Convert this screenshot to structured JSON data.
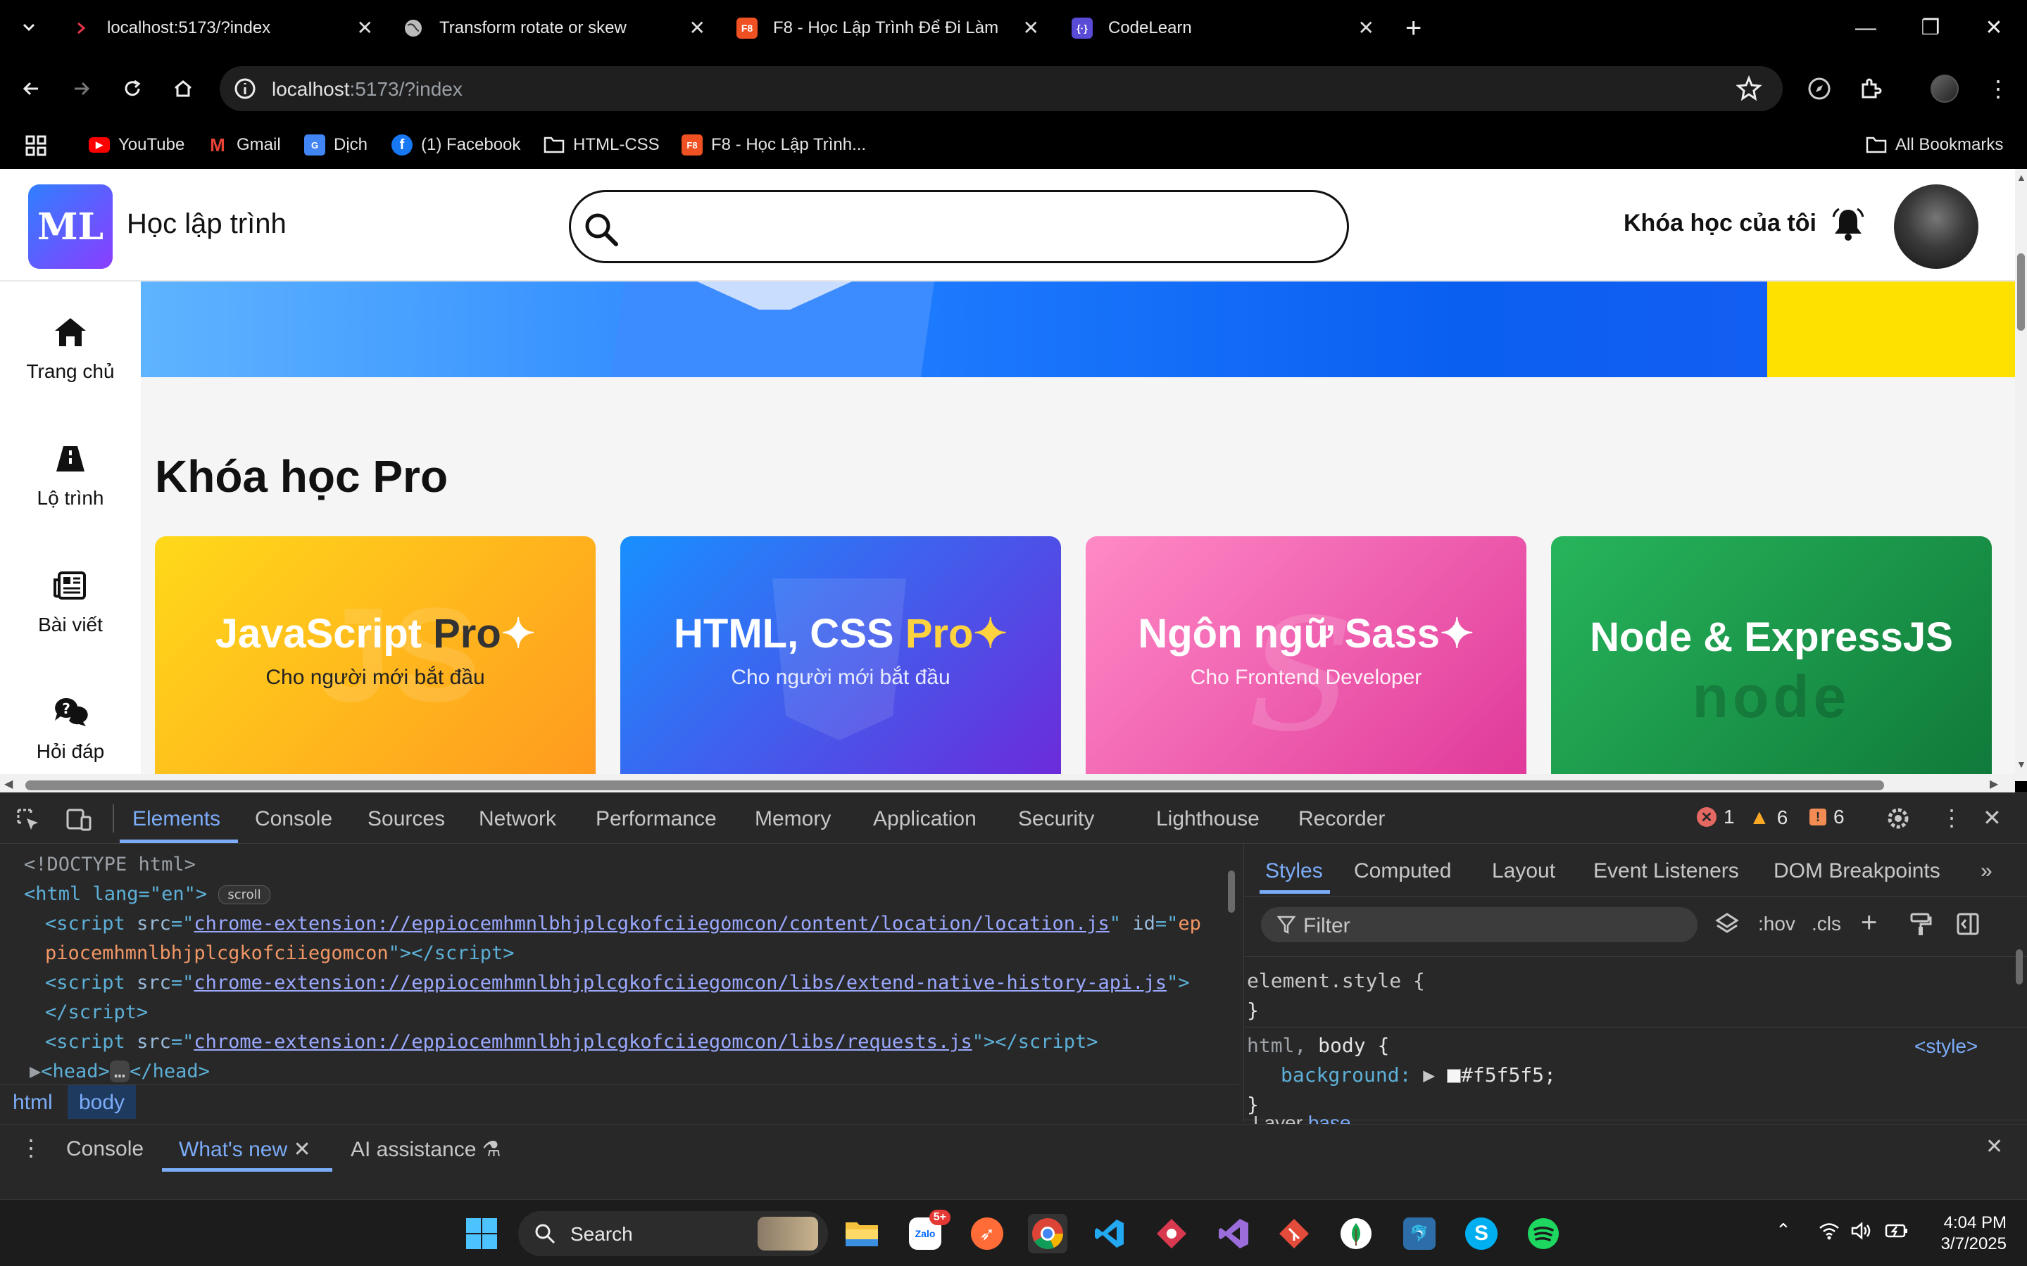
{
  "browser": {
    "tabs": [
      {
        "title": "localhost:5173/?index",
        "icon": "angular-icon"
      },
      {
        "title": "Transform rotate or skew",
        "icon": "globe-icon"
      },
      {
        "title": "F8 - Học Lập Trình Để Đi Làm",
        "icon": "f8-icon",
        "badge": "F8"
      },
      {
        "title": "CodeLearn",
        "icon": "codelearn-icon"
      }
    ],
    "url": {
      "host": "localhost",
      "rest": ":5173/?index"
    },
    "bookmarks": [
      {
        "label": "YouTube",
        "icon": "youtube-icon"
      },
      {
        "label": "Gmail",
        "icon": "gmail-icon"
      },
      {
        "label": "Dịch",
        "icon": "translate-icon"
      },
      {
        "label": "(1) Facebook",
        "icon": "facebook-icon"
      },
      {
        "label": "HTML-CSS",
        "icon": "folder-icon"
      },
      {
        "label": "F8 - Học Lập Trình...",
        "icon": "f8-icon",
        "badge": "F8"
      }
    ],
    "all_bookmarks": "All Bookmarks"
  },
  "site": {
    "logo": "ML",
    "brand": "Học lập trình",
    "my_courses": "Khóa học của tôi",
    "nav": [
      {
        "label": "Trang chủ",
        "icon": "home-icon"
      },
      {
        "label": "Lộ trình",
        "icon": "road-icon"
      },
      {
        "label": "Bài viết",
        "icon": "newspaper-icon"
      },
      {
        "label": "Hỏi đáp",
        "icon": "chat-question-icon"
      }
    ],
    "section_title": "Khóa học Pro",
    "courses": [
      {
        "title": "JavaScript",
        "pro": "Pro",
        "subtitle": "Cho người mới bắt đầu",
        "bg1": "#ffd91a",
        "bg2": "#ff9a1f"
      },
      {
        "title": "HTML, CSS",
        "pro": "Pro",
        "subtitle": "Cho người mới bắt đầu",
        "bg1": "#1890ff",
        "bg2": "#6c2bd9"
      },
      {
        "title": "Ngôn ngữ Sass",
        "subtitle": "Cho Frontend Developer",
        "bg1": "#ff8ac6",
        "bg2": "#e0399a"
      },
      {
        "title": "Node & ExpressJS",
        "subtitle": "",
        "bg1": "#27b55b",
        "bg2": "#107a3a"
      }
    ]
  },
  "devtools": {
    "tabs": [
      "Elements",
      "Console",
      "Sources",
      "Network",
      "Performance",
      "Memory",
      "Application",
      "Security",
      "Lighthouse",
      "Recorder"
    ],
    "errors": "1",
    "warnings": "6",
    "issues": "6",
    "code": {
      "doctype": "<!DOCTYPE html>",
      "html_open": "<html lang=\"en\">",
      "scroll_badge": "scroll",
      "script1_src": "chrome-extension://eppiocemhmnlbhjplcgkofciiegomcon/content/location/location.js",
      "script1_id_a": "ep",
      "script1_id_b": "piocemhmnlbhjplcgkofciiegomcon",
      "script2_src": "chrome-extension://eppiocemhmnlbhjplcgkofciiegomcon/libs/extend-native-history-api.js",
      "script3_src": "chrome-extension://eppiocemhmnlbhjplcgkofciiegomcon/libs/requests.js",
      "head": "<head>",
      "head_close": "</head>"
    },
    "breadcrumbs": [
      "html",
      "body"
    ],
    "styles_tabs": [
      "Styles",
      "Computed",
      "Layout",
      "Event Listeners",
      "DOM Breakpoints"
    ],
    "filter_placeholder": "Filter",
    "hov": ":hov",
    "cls": ".cls",
    "rules": {
      "element_style": "element.style {",
      "close": "}",
      "selector_dim": "html,",
      "selector": "body {",
      "source": "<style>",
      "prop": "background:",
      "value": "#f5f5f5;",
      "swatch": "#f5f5f5",
      "layer": "Layer",
      "layer_name": "base"
    },
    "drawer_tabs": [
      "Console",
      "What's new",
      "AI assistance"
    ]
  },
  "taskbar": {
    "search": "Search",
    "time": "4:04 PM",
    "date": "3/7/2025",
    "zalo_badge": "5+"
  }
}
